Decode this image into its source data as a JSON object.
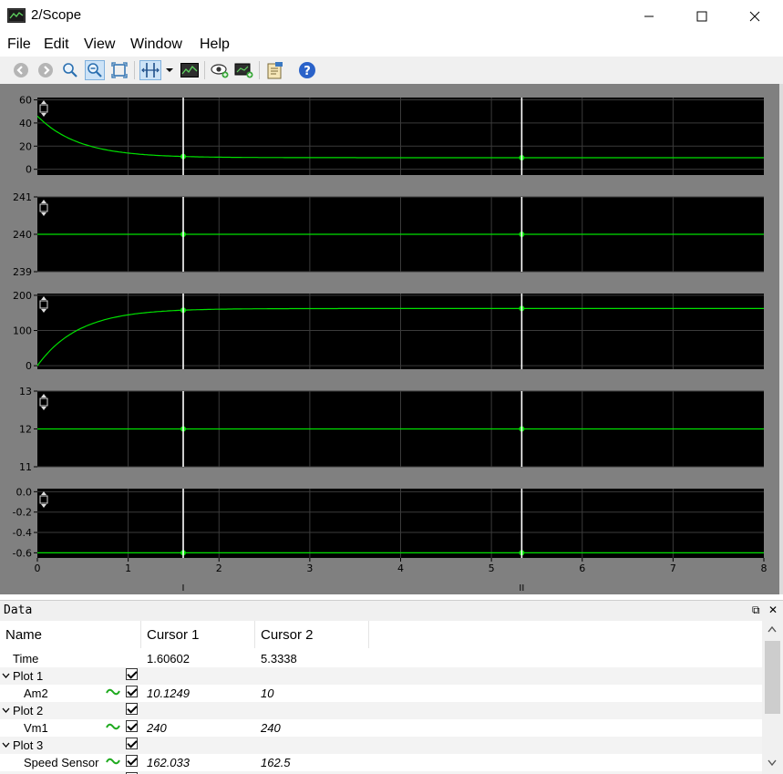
{
  "window": {
    "title": "2/Scope"
  },
  "menu": [
    "File",
    "Edit",
    "View",
    "Window",
    "Help"
  ],
  "toolbar": {
    "icons": [
      "back-icon",
      "forward-icon",
      "zoom-in-icon",
      "zoom-out-icon",
      "fit-icon",
      "cursor-icon",
      "dropdown-icon",
      "trace-icon",
      "visibility-icon",
      "add-plot-icon",
      "properties-icon",
      "help-icon"
    ]
  },
  "colors": {
    "trace": "#00e000",
    "background": "#000000",
    "frame": "#808080",
    "cursor": "#ffffff"
  },
  "chart_data": [
    {
      "type": "line",
      "ylim": [
        -5,
        62
      ],
      "yticks": [
        0,
        20,
        40,
        60
      ],
      "ytick_labels": [
        "0",
        "20",
        "40",
        "60"
      ],
      "series": [
        {
          "name": "Am2",
          "kind": "decay",
          "start": 46,
          "end": 10,
          "rate": 2.2
        }
      ]
    },
    {
      "type": "line",
      "ylim": [
        239,
        241
      ],
      "yticks": [
        239,
        240,
        241
      ],
      "ytick_labels": [
        "239",
        "240",
        "241"
      ],
      "series": [
        {
          "name": "Vm1",
          "kind": "const",
          "value": 240
        }
      ]
    },
    {
      "type": "line",
      "ylim": [
        -10,
        205
      ],
      "yticks": [
        0,
        100,
        200
      ],
      "ytick_labels": [
        "0",
        "100",
        "200"
      ],
      "series": [
        {
          "name": "Speed Sensor",
          "kind": "rise",
          "start": 0,
          "end": 162.5,
          "rate": 2.2
        }
      ]
    },
    {
      "type": "line",
      "ylim": [
        11,
        13
      ],
      "yticks": [
        11,
        12,
        13
      ],
      "ytick_labels": [
        "11",
        "12",
        "13"
      ],
      "series": [
        {
          "kind": "const",
          "value": 12
        }
      ]
    },
    {
      "type": "line",
      "ylim": [
        -0.65,
        0.03
      ],
      "yticks": [
        0,
        -0.2,
        -0.4,
        -0.6
      ],
      "ytick_labels": [
        "0.0",
        "-0.2",
        "-0.4",
        "-0.6"
      ],
      "series": [
        {
          "kind": "const",
          "value": -0.6
        }
      ]
    }
  ],
  "xaxis": {
    "xlim": [
      0,
      8
    ],
    "ticks": [
      0,
      1,
      2,
      3,
      4,
      5,
      6,
      7,
      8
    ],
    "labels": [
      "0",
      "1",
      "2",
      "3",
      "4",
      "5",
      "6",
      "7",
      "8"
    ]
  },
  "cursors": [
    {
      "label": "I",
      "x": 1.60602
    },
    {
      "label": "II",
      "x": 5.3338
    }
  ],
  "data_panel": {
    "title": "Data",
    "dock_float": "⧉",
    "dock_close": "✕",
    "columns": [
      "Name",
      "Cursor 1",
      "Cursor 2"
    ],
    "rows": [
      {
        "name": "Time",
        "c1": "1.60602",
        "c2": "5.3338",
        "level": 1,
        "type": "time"
      },
      {
        "name": "Plot 1",
        "level": 0,
        "type": "group"
      },
      {
        "name": "Am2",
        "c1": "10.1249",
        "c2": "10",
        "level": 1,
        "type": "signal"
      },
      {
        "name": "Plot 2",
        "level": 0,
        "type": "group"
      },
      {
        "name": "Vm1",
        "c1": "240",
        "c2": "240",
        "level": 1,
        "type": "signal"
      },
      {
        "name": "Plot 3",
        "level": 0,
        "type": "group"
      },
      {
        "name": "Speed Sensor",
        "c1": "162.033",
        "c2": "162.5",
        "level": 1,
        "type": "signal"
      }
    ]
  }
}
